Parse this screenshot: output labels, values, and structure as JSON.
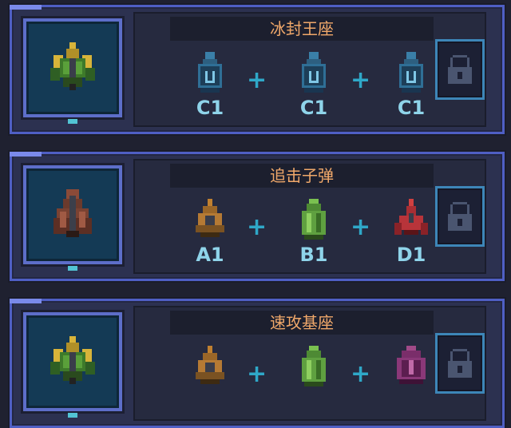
{
  "recipes": [
    {
      "title": "冰封王座",
      "result_icon": "green-gold-ship-icon",
      "ingredients": [
        {
          "code": "C1",
          "icon": "blue-bomb-ship-icon"
        },
        {
          "code": "C1",
          "icon": "blue-bomb-ship-icon"
        },
        {
          "code": "C1",
          "icon": "blue-bomb-ship-icon"
        }
      ],
      "lock_icon": "lock-icon"
    },
    {
      "title": "追击子弹",
      "result_icon": "brown-tank-ship-icon",
      "ingredients": [
        {
          "code": "A1",
          "icon": "orange-drill-ship-icon"
        },
        {
          "code": "B1",
          "icon": "green-capsule-ship-icon"
        },
        {
          "code": "D1",
          "icon": "red-arrow-ship-icon"
        }
      ],
      "lock_icon": "lock-icon"
    },
    {
      "title": "速攻基座",
      "result_icon": "green-gold-ship-icon",
      "ingredients": [
        {
          "code": "",
          "icon": "orange-drill-ship-icon"
        },
        {
          "code": "",
          "icon": "green-capsule-ship-icon"
        },
        {
          "code": "",
          "icon": "purple-hull-ship-icon"
        }
      ],
      "lock_icon": "lock-icon"
    }
  ],
  "plus_symbol": "+",
  "colors": {
    "background": "#1f2130",
    "card_border": "#4f5fc4",
    "title_text": "#f0a86a",
    "code_text": "#8fd4ea",
    "plus": "#2fa8c8"
  }
}
